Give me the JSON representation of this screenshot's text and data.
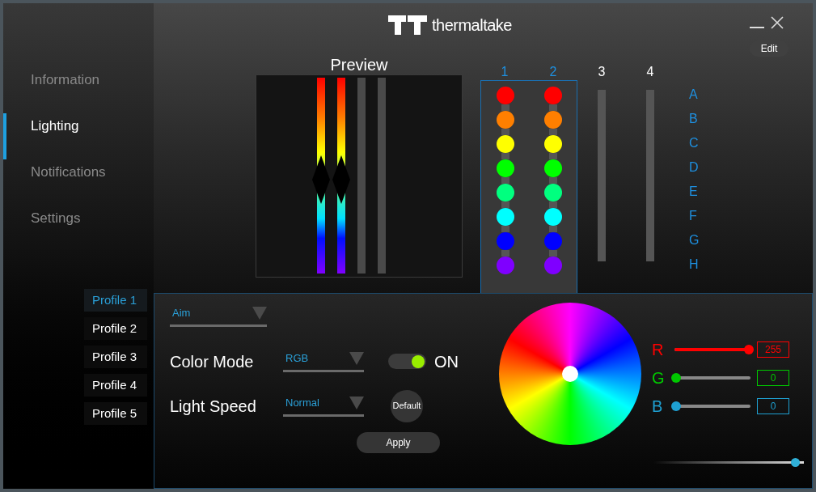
{
  "header": {
    "brand": "thermaltake",
    "edit_button": "Edit"
  },
  "sidebar": {
    "items": [
      {
        "label": "Information",
        "selected": false
      },
      {
        "label": "Lighting",
        "selected": true
      },
      {
        "label": "Notifications",
        "selected": false
      },
      {
        "label": "Settings",
        "selected": false
      }
    ]
  },
  "profiles": [
    {
      "label": "Profile 1",
      "selected": true
    },
    {
      "label": "Profile 2",
      "selected": false
    },
    {
      "label": "Profile 3",
      "selected": false
    },
    {
      "label": "Profile 4",
      "selected": false
    },
    {
      "label": "Profile 5",
      "selected": false
    }
  ],
  "preview": {
    "title": "Preview",
    "strips": [
      {
        "lit": true
      },
      {
        "lit": true
      },
      {
        "lit": false
      },
      {
        "lit": false
      }
    ]
  },
  "fans": [
    {
      "label": "1",
      "selected": true,
      "leds": [
        {
          "color": "#ff0000"
        },
        {
          "color": "#ff7f00"
        },
        {
          "color": "#ffff00"
        },
        {
          "color": "#00ff00"
        },
        {
          "color": "#00ff7f"
        },
        {
          "color": "#00ffff"
        },
        {
          "color": "#0000ff"
        },
        {
          "color": "#7f00ff"
        }
      ]
    },
    {
      "label": "2",
      "selected": true,
      "leds": [
        {
          "color": "#ff0000"
        },
        {
          "color": "#ff7f00"
        },
        {
          "color": "#ffff00"
        },
        {
          "color": "#00ff00"
        },
        {
          "color": "#00ff7f"
        },
        {
          "color": "#00ffff"
        },
        {
          "color": "#0000ff"
        },
        {
          "color": "#7f00ff"
        }
      ]
    },
    {
      "label": "3",
      "selected": false
    },
    {
      "label": "4",
      "selected": false
    }
  ],
  "led_rows": [
    "A",
    "B",
    "C",
    "D",
    "E",
    "F",
    "G",
    "H"
  ],
  "effect": {
    "value": "Aim"
  },
  "color_mode": {
    "label": "Color Mode",
    "value": "RGB",
    "toggle": {
      "on": true,
      "label": "ON"
    }
  },
  "light_speed": {
    "label": "Light Speed",
    "value": "Normal",
    "default_button": "Default"
  },
  "apply_button": "Apply",
  "rgb": [
    {
      "channel": "R",
      "color": "#ff0000",
      "level": 1,
      "value": "255"
    },
    {
      "channel": "G",
      "color": "#00c800",
      "level": 0,
      "value": "0"
    },
    {
      "channel": "B",
      "color": "#1ea0d2",
      "level": 0,
      "value": "0"
    }
  ],
  "brightness": {
    "level": 0.97
  }
}
